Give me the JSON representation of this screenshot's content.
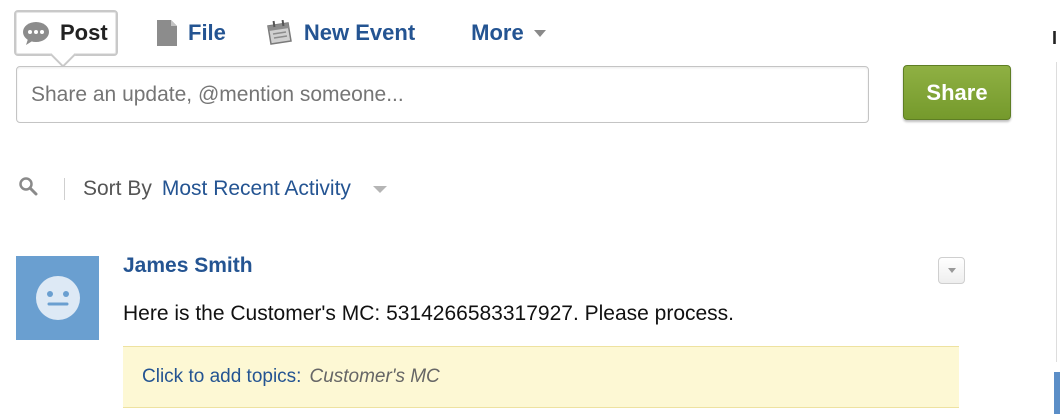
{
  "publisher": {
    "tabs": [
      {
        "label": "Post",
        "icon": "speech-bubble-icon"
      },
      {
        "label": "File",
        "icon": "file-icon"
      },
      {
        "label": "New Event",
        "icon": "calendar-icon"
      },
      {
        "label": "More",
        "icon": "chevron-down-icon"
      }
    ],
    "share_placeholder": "Share an update, @mention someone...",
    "share_button": "Share"
  },
  "feed": {
    "sort_label": "Sort By",
    "sort_value": "Most Recent Activity",
    "items": [
      {
        "author": "James Smith",
        "body": "Here is the Customer's MC:  5314266583317927.  Please process.",
        "topics_link": "Click to add topics:",
        "topics_tag": "Customer's MC"
      }
    ]
  },
  "right_panel": {
    "truncated_heading": "I"
  },
  "colors": {
    "link": "#245492",
    "share_button": "#7ea235",
    "avatar_bg": "#6a9fd0",
    "topics_bg": "#fdf8d4"
  }
}
